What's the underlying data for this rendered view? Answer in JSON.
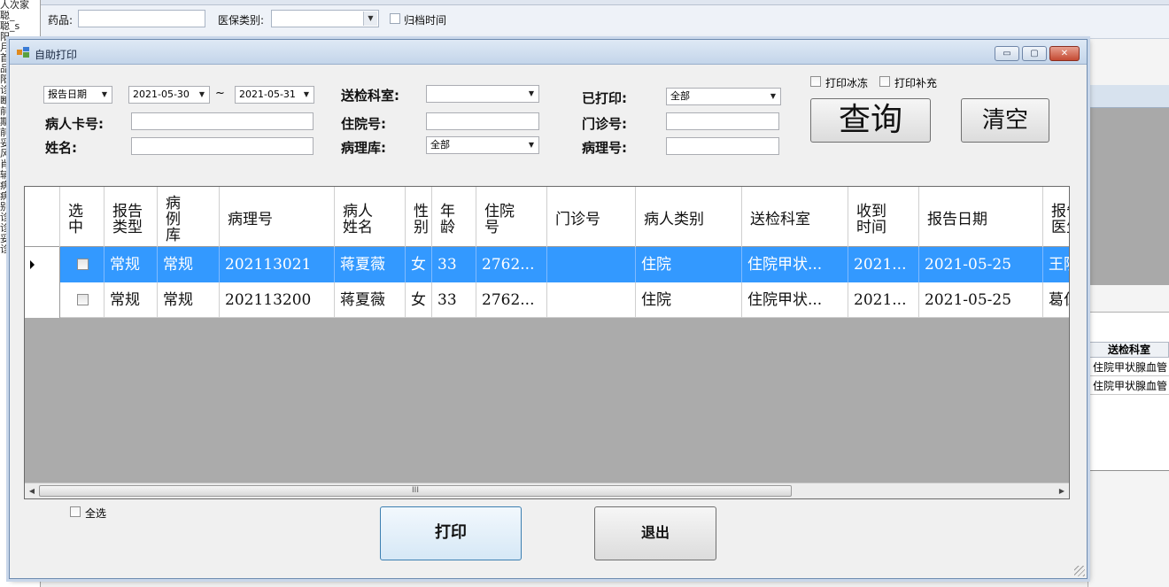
{
  "background": {
    "left_strip_fragments": [
      "人次家",
      "聪_",
      "聪_s",
      "阳",
      "月",
      "首",
      "品",
      "阳",
      "诊",
      "断",
      "前",
      "期",
      "前",
      "妥",
      "风",
      "肖",
      "辅",
      "病",
      "病",
      "别",
      "诊",
      "诊",
      "妥",
      "诊"
    ],
    "filters": {
      "drug_label": "药品:",
      "insurance_label": "医保类别:",
      "archive_time_label": "归档时间"
    },
    "right_table": {
      "column_header": "送检科室",
      "rows": [
        "住院甲状腺血管",
        "住院甲状腺血管"
      ]
    }
  },
  "dialog": {
    "title": "自助打印",
    "window_buttons": {
      "minimize": "▭",
      "maximize": "▢",
      "close": "✕"
    },
    "form": {
      "date_type": {
        "value": "报告日期"
      },
      "date_from": "2021-05-30",
      "date_separator": "~",
      "date_to": "2021-05-31",
      "send_dept": {
        "label": "送检科室:",
        "value": ""
      },
      "printed": {
        "label": "已打印:",
        "value": "全部"
      },
      "patient_card": {
        "label": "病人卡号:",
        "value": ""
      },
      "inpatient_no": {
        "label": "住院号:",
        "value": ""
      },
      "outpatient_no": {
        "label": "门诊号:",
        "value": ""
      },
      "name": {
        "label": "姓名:",
        "value": ""
      },
      "pathology_lib": {
        "label": "病理库:",
        "value": "全部"
      },
      "pathology_no": {
        "label": "病理号:",
        "value": ""
      },
      "print_frozen_label": "打印冰冻",
      "print_supplement_label": "打印补充"
    },
    "buttons": {
      "query": "查询",
      "clear": "清空",
      "print": "打印",
      "exit": "退出"
    },
    "select_all_label": "全选",
    "grid": {
      "columns": [
        [
          "选",
          "中"
        ],
        [
          "报告",
          "类型"
        ],
        [
          "病",
          "例",
          "库"
        ],
        [
          "病理号"
        ],
        [
          "病人",
          "姓名"
        ],
        [
          "性",
          "别"
        ],
        [
          "年",
          "龄"
        ],
        [
          "住院",
          "号"
        ],
        [
          "门诊号"
        ],
        [
          "病人类别"
        ],
        [
          "送检科室"
        ],
        [
          "收到",
          "时间"
        ],
        [
          "报告日期"
        ],
        [
          "报告",
          "医生"
        ]
      ],
      "rows": [
        {
          "selected": true,
          "cells": [
            "",
            "常规",
            "常规",
            "202113021",
            "蒋夏薇",
            "女",
            "33",
            "2762...",
            "",
            "住院",
            "住院甲状...",
            "2021...",
            "2021-05-25",
            "王院"
          ]
        },
        {
          "selected": false,
          "cells": [
            "",
            "常规",
            "常规",
            "202113200",
            "蒋夏薇",
            "女",
            "33",
            "2762...",
            "",
            "住院",
            "住院甲状...",
            "2021...",
            "2021-05-25",
            "葛仁"
          ]
        }
      ],
      "scroll_thumb_label": "III"
    },
    "colors": {
      "selection": "#3399ff",
      "grid_empty": "#ababab",
      "print_border": "#3c7fb1"
    }
  }
}
